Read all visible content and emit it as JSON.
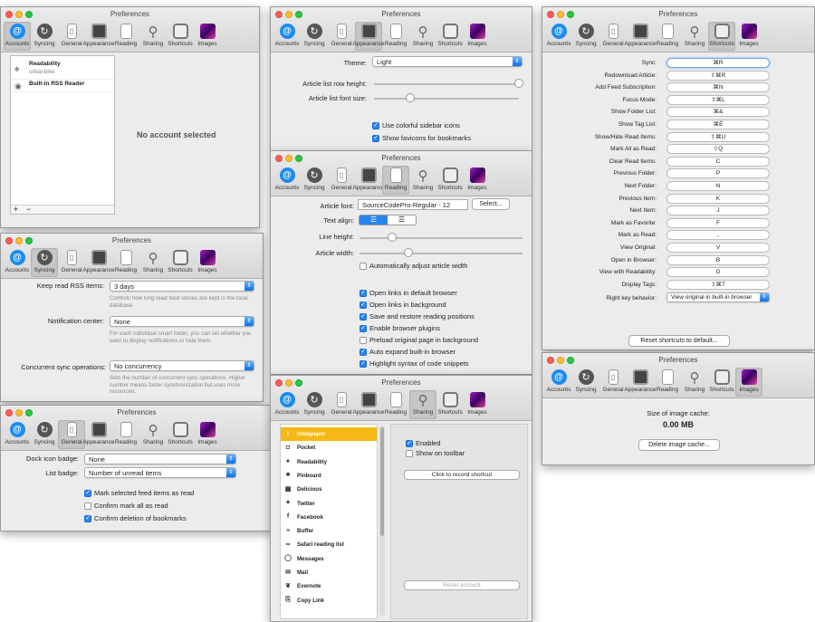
{
  "app_title": "Preferences",
  "toolbar": [
    "Accounts",
    "Syncing",
    "General",
    "Appearance",
    "Reading",
    "Sharing",
    "Shortcuts",
    "Images"
  ],
  "accounts": {
    "items": [
      {
        "name": "Readability",
        "sub": "urbanbike"
      },
      {
        "name": "Built-in RSS Reader",
        "sub": ""
      }
    ],
    "add": "+",
    "remove": "−",
    "empty_text": "No account selected"
  },
  "syncing": {
    "keep_label": "Keep read RSS items:",
    "keep_value": "3 days",
    "keep_help": "Controls how long read feed stories are kept in the local database.",
    "notif_label": "Notification center:",
    "notif_value": "None",
    "notif_help": "For each individual smart folder, you can set whether you want to display notifications or hide them.",
    "conc_label": "Concurrent sync operations:",
    "conc_value": "No concurrency",
    "conc_help": "Sets the number of concurrent sync operations. Higher number means faster synchronization but uses more resources."
  },
  "general": {
    "dock_label": "Dock icon badge:",
    "dock_value": "None",
    "list_label": "List badge:",
    "list_value": "Number of unread items",
    "checks": [
      {
        "label": "Mark selected feed items as read",
        "on": true
      },
      {
        "label": "Confirm mark all as read",
        "on": false
      },
      {
        "label": "Confirm deletion of bookmarks",
        "on": true
      }
    ]
  },
  "appearance": {
    "theme_label": "Theme:",
    "theme_value": "Light",
    "row_label": "Article list row height:",
    "row_value": 1.0,
    "font_label": "Article list font size:",
    "font_value": 0.25,
    "checks": [
      {
        "label": "Use colorful sidebar icons",
        "on": true
      },
      {
        "label": "Show favicons for bookmarks",
        "on": true
      }
    ]
  },
  "reading": {
    "font_label": "Article font:",
    "font_value": "SourceCodePro-Regular - 12",
    "select_btn": "Select...",
    "align_label": "Text align:",
    "lh_label": "Line height:",
    "lh_value": 0.2,
    "aw_label": "Article width:",
    "aw_value": 0.3,
    "auto_width": {
      "label": "Automatically adjust article width",
      "on": false
    },
    "checks": [
      {
        "label": "Open links in default browser",
        "on": true
      },
      {
        "label": "Open links in background",
        "on": true
      },
      {
        "label": "Save and restore reading positions",
        "on": true
      },
      {
        "label": "Enable browser plugins",
        "on": true
      },
      {
        "label": "Preload original page in background",
        "on": false
      },
      {
        "label": "Auto expand built-in browser",
        "on": true
      },
      {
        "label": "Highlight syntax of code snippets",
        "on": true
      }
    ]
  },
  "sharing": {
    "services": [
      {
        "name": "Instapaper",
        "icon": "I",
        "sel": true
      },
      {
        "name": "Pocket",
        "icon": "◘"
      },
      {
        "name": "Readability",
        "icon": "♠"
      },
      {
        "name": "Pinboard",
        "icon": "■"
      },
      {
        "name": "Delicious",
        "icon": "▩"
      },
      {
        "name": "Twitter",
        "icon": "✦"
      },
      {
        "name": "Facebook",
        "icon": "f"
      },
      {
        "name": "Buffer",
        "icon": "≡"
      },
      {
        "name": "Safari reading list",
        "icon": "∞"
      },
      {
        "name": "Messages",
        "icon": "◯"
      },
      {
        "name": "Mail",
        "icon": "✉"
      },
      {
        "name": "Evernote",
        "icon": "❦"
      },
      {
        "name": "Copy Link",
        "icon": "⎘"
      }
    ],
    "enabled": {
      "label": "Enabled",
      "on": true
    },
    "toolbar": {
      "label": "Show on toolbar",
      "on": false
    },
    "record_btn": "Click to record shortcut",
    "reset_btn": "Reset account"
  },
  "shortcuts": {
    "rows": [
      {
        "label": "Sync:",
        "key": "⌘R"
      },
      {
        "label": "Redownload Article:",
        "key": "⇧⌘R"
      },
      {
        "label": "Add Feed Subscription:",
        "key": "⌘N"
      },
      {
        "label": "Focus Mode:",
        "key": "⇧⌘L"
      },
      {
        "label": "Show Folder List:",
        "key": "⌘&"
      },
      {
        "label": "Show Tag List:",
        "key": "⌘É"
      },
      {
        "label": "Show/Hide Read Items:",
        "key": "⇧⌘U"
      },
      {
        "label": "Mark All as Read:",
        "key": "⇧Q"
      },
      {
        "label": "Clear Read Items:",
        "key": "C"
      },
      {
        "label": "Previous Folder:",
        "key": "P"
      },
      {
        "label": "Next Folder:",
        "key": "N"
      },
      {
        "label": "Previous Item:",
        "key": "K"
      },
      {
        "label": "Next Item:",
        "key": "J"
      },
      {
        "label": "Mark as Favorite:",
        "key": "F"
      },
      {
        "label": "Mark as Read:",
        "key": ","
      },
      {
        "label": "View Original:",
        "key": "V"
      },
      {
        "label": "Open in Browser:",
        "key": "B"
      },
      {
        "label": "View with Readability:",
        "key": "G"
      },
      {
        "label": "Display Tags:",
        "key": "⇧⌘T"
      }
    ],
    "rk_label": "Right key behavior:",
    "rk_value": "View original in built-in browser",
    "reset_btn": "Reset shortcuts to default..."
  },
  "images": {
    "size_label": "Size of image cache:",
    "size_value": "0.00 MB",
    "delete_btn": "Delete image cache..."
  }
}
